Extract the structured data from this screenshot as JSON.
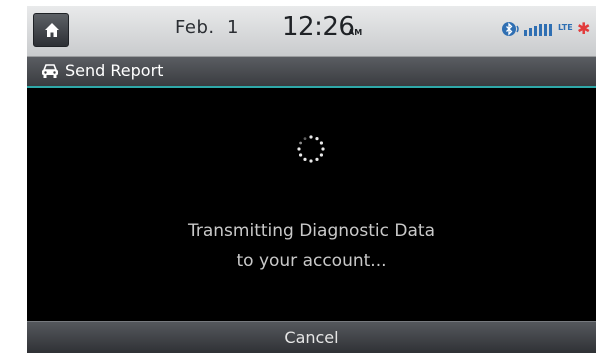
{
  "status_bar": {
    "date": "Feb.  1",
    "time": "12:26",
    "ampm": "AM",
    "network_label": "LTE"
  },
  "title_bar": {
    "title": "Send Report"
  },
  "main": {
    "message_line1": "Transmitting Diagnostic Data",
    "message_line2": "to your account..."
  },
  "footer": {
    "cancel_label": "Cancel"
  },
  "icons": {
    "home": "home-icon",
    "bluetooth": "bluetooth-icon",
    "signal": "signal-icon",
    "alert": "alert-icon",
    "car": "car-icon",
    "spinner": "loading-spinner-icon"
  },
  "colors": {
    "accent_line": "#2fa8a8",
    "alert": "#e23b3b",
    "message_text": "#c9c9c9"
  }
}
